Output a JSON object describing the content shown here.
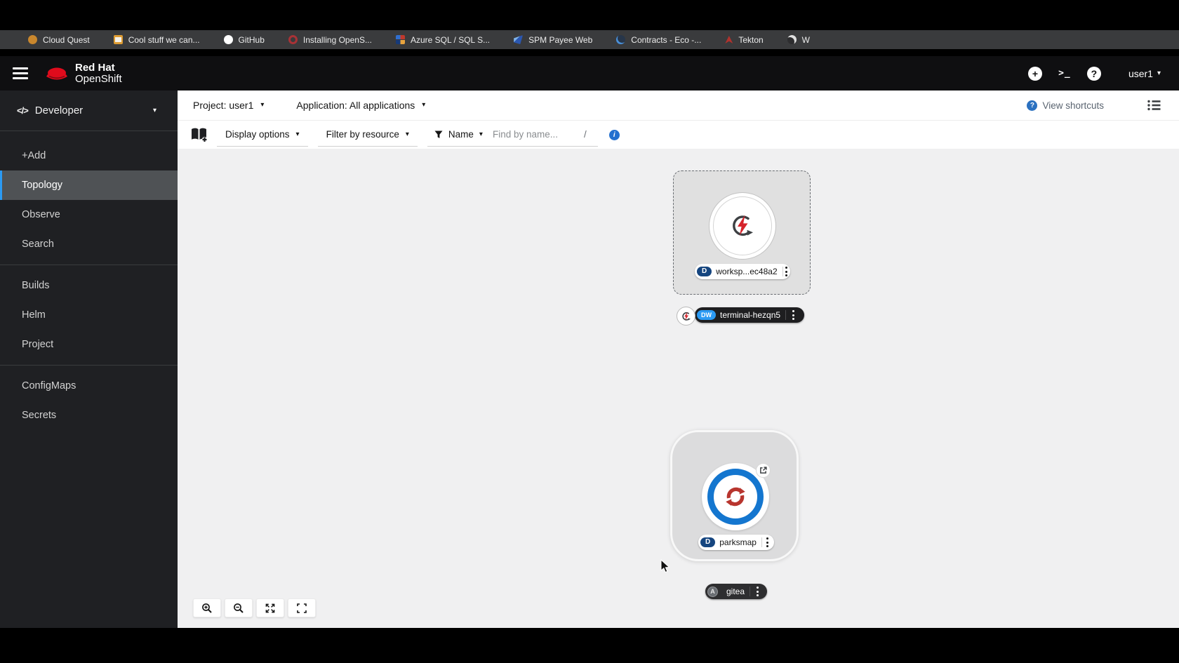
{
  "bookmarks_bar": {
    "items": [
      {
        "label": "Cloud Quest",
        "icon": "cloud-quest-favicon"
      },
      {
        "label": "Cool stuff we can...",
        "icon": "folder-favicon"
      },
      {
        "label": "GitHub",
        "icon": "github-favicon"
      },
      {
        "label": "Installing OpenS...",
        "icon": "openshift-favicon"
      },
      {
        "label": "Azure SQL / SQL S...",
        "icon": "azure-favicon"
      },
      {
        "label": "SPM Payee Web",
        "icon": "spm-favicon"
      },
      {
        "label": "Contracts - Eco -...",
        "icon": "globe-favicon"
      },
      {
        "label": "Tekton",
        "icon": "tekton-favicon"
      },
      {
        "label": "W",
        "icon": "globe-favicon"
      }
    ]
  },
  "masthead": {
    "brand_line1": "Red Hat",
    "brand_line2": "OpenShift",
    "user": "user1"
  },
  "sidebar": {
    "perspective": "Developer",
    "items": [
      {
        "label": "+Add"
      },
      {
        "label": "Topology",
        "active": true
      },
      {
        "label": "Observe"
      },
      {
        "label": "Search"
      },
      {
        "label": "Builds"
      },
      {
        "label": "Helm"
      },
      {
        "label": "Project"
      },
      {
        "label": "ConfigMaps"
      },
      {
        "label": "Secrets"
      }
    ]
  },
  "context_bar": {
    "project": "Project: user1",
    "application": "Application: All applications",
    "view_shortcuts": "View shortcuts"
  },
  "filter_bar": {
    "display_options": "Display options",
    "filter_by_resource": "Filter by resource",
    "name": "Name",
    "find_placeholder": "Find by name...",
    "shortcut": "/"
  },
  "topology": {
    "workspace": {
      "badge": "D",
      "label": "worksp...ec48a2"
    },
    "terminal": {
      "badge": "DW",
      "label": "terminal-hezqn5"
    },
    "parksmap": {
      "badge": "D",
      "label": "parksmap"
    },
    "gitea": {
      "badge": "A",
      "label": "gitea"
    }
  },
  "colors": {
    "accent_blue": "#2b9af3",
    "badge_navy": "#15457f",
    "node_ring_blue": "#1476cf",
    "icon_red": "#c9252d"
  }
}
